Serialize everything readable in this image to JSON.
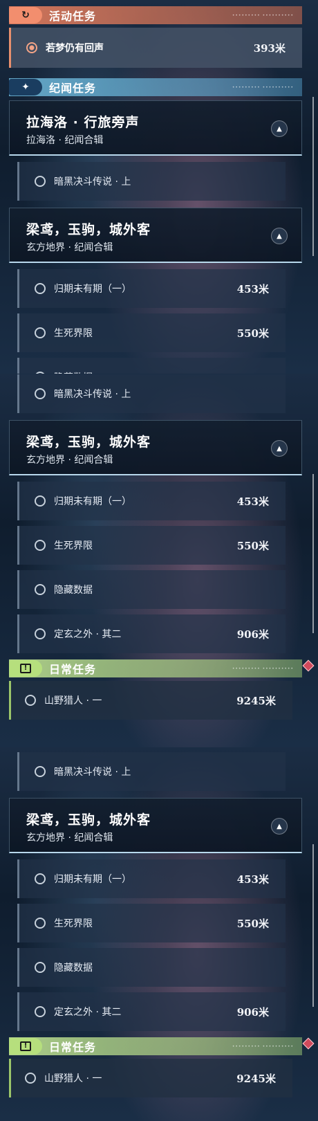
{
  "active": {
    "header": "活动任务",
    "deco": "••••••••• ••••••••••",
    "task": {
      "label": "若梦仍有回声",
      "distance": "393米"
    }
  },
  "lore": {
    "header": "纪闻任务",
    "deco": "••••••••• ••••••••••",
    "group1": {
      "title": "拉海洛 · 行旅旁声",
      "subtitle": "拉海洛 · 纪闻合辑"
    },
    "group1_task": {
      "label": "暗黑决斗传说 · 上"
    },
    "group2": {
      "title": "梁鸢，玉驹，城外客",
      "subtitle": "玄方地界 · 纪闻合辑"
    },
    "group2_tasks": [
      {
        "label": "归期未有期（一）",
        "distance": "453米"
      },
      {
        "label": "生死界限",
        "distance": "550米"
      },
      {
        "label": "隐藏数据",
        "distance": ""
      },
      {
        "label": "定玄之外 · 其二",
        "distance": "906米"
      }
    ]
  },
  "daily": {
    "header": "日常任务",
    "deco": "••••••••• ••••••••••",
    "task": {
      "label": "山野猎人 · 一",
      "distance": "9245米"
    }
  },
  "colors": {
    "active_accent": "#f28e6e",
    "lore_accent": "#78c8eb",
    "daily_accent": "#b6df7d",
    "marker": "#d04a5c"
  },
  "icons": {
    "active": "refresh-arrow-icon",
    "lore": "sparkle-star-icon",
    "daily": "exclamation-icon",
    "expand": "chevron-up-icon",
    "waypoint": "diamond-marker-icon"
  }
}
